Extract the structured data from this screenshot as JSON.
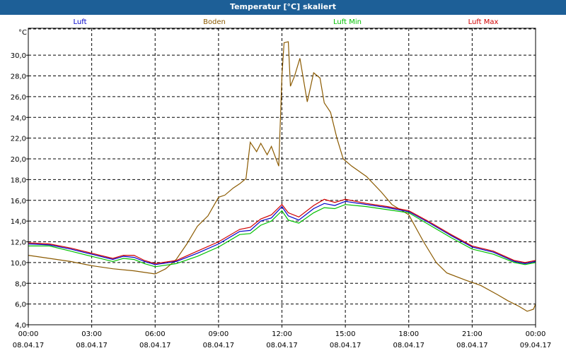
{
  "window": {
    "title": "Temperatur [°C] skaliert"
  },
  "chart_data": {
    "type": "line",
    "title": "Temperatur [°C] skaliert",
    "ylabel": "°C",
    "xlabel": "",
    "ylim": [
      4,
      32.6
    ],
    "xlim": [
      0,
      24
    ],
    "grid": true,
    "legend_position": "top",
    "yticks": [
      "4,0",
      "6,0",
      "8,0",
      "10,0",
      "12,0",
      "14,0",
      "16,0",
      "18,0",
      "20,0",
      "22,0",
      "24,0",
      "26,0",
      "28,0",
      "30,0"
    ],
    "xticks": [
      {
        "time": "00:00",
        "date": "08.04.17"
      },
      {
        "time": "03:00",
        "date": "08.04.17"
      },
      {
        "time": "06:00",
        "date": "08.04.17"
      },
      {
        "time": "09:00",
        "date": "08.04.17"
      },
      {
        "time": "12:00",
        "date": "08.04.17"
      },
      {
        "time": "15:00",
        "date": "08.04.17"
      },
      {
        "time": "18:00",
        "date": "08.04.17"
      },
      {
        "time": "21:00",
        "date": "08.04.17"
      },
      {
        "time": "00:00",
        "date": "09.04.17"
      }
    ],
    "series": [
      {
        "name": "Luft",
        "color": "#0000c8",
        "x": [
          0,
          1,
          2,
          3,
          4,
          4.5,
          5,
          5.5,
          6,
          7,
          8,
          9,
          10,
          10.5,
          11,
          11.5,
          12,
          12.3,
          12.8,
          13.5,
          14,
          14.5,
          15,
          16,
          17,
          18,
          19,
          20,
          21,
          22,
          23,
          23.5,
          24
        ],
        "y": [
          11.8,
          11.7,
          11.3,
          10.8,
          10.3,
          10.6,
          10.5,
          10.1,
          9.8,
          10.1,
          10.9,
          11.8,
          13.0,
          13.1,
          14.0,
          14.3,
          15.4,
          14.5,
          14.1,
          15.2,
          15.7,
          15.5,
          15.9,
          15.6,
          15.3,
          14.9,
          13.8,
          12.6,
          11.5,
          11.0,
          10.1,
          9.9,
          10.1
        ]
      },
      {
        "name": "Boden",
        "color": "#8b5a00",
        "x": [
          0,
          1,
          2,
          3,
          4,
          5,
          6,
          6.5,
          7,
          7.5,
          8,
          8.5,
          9,
          9.3,
          9.7,
          10,
          10.3,
          10.5,
          10.8,
          11,
          11.3,
          11.5,
          11.85,
          12.0,
          12.1,
          12.3,
          12.4,
          12.6,
          12.85,
          13.2,
          13.5,
          13.8,
          14.0,
          14.3,
          14.6,
          14.9,
          15.3,
          16,
          16.7,
          17.2,
          18,
          18.7,
          19.3,
          19.8,
          20.7,
          21.4,
          22.2,
          22.7,
          23.2,
          23.6,
          23.9,
          24
        ],
        "y": [
          10.7,
          10.4,
          10.1,
          9.7,
          9.4,
          9.2,
          8.9,
          9.4,
          10.3,
          11.8,
          13.5,
          14.5,
          16.3,
          16.5,
          17.2,
          17.6,
          18.1,
          21.6,
          20.7,
          21.5,
          20.4,
          21.2,
          19.3,
          28.0,
          31.2,
          31.3,
          27.0,
          28.0,
          29.7,
          25.5,
          28.3,
          27.8,
          25.4,
          24.5,
          22.0,
          20.0,
          19.3,
          18.3,
          16.8,
          15.6,
          14.6,
          12.0,
          10.0,
          9.0,
          8.3,
          7.8,
          6.9,
          6.3,
          5.8,
          5.3,
          5.5,
          6.0
        ]
      },
      {
        "name": "Luft Min",
        "color": "#00c000",
        "x": [
          0,
          1,
          2,
          3,
          4,
          4.5,
          5,
          5.5,
          6,
          7,
          8,
          9,
          10,
          10.5,
          11,
          11.5,
          12,
          12.3,
          12.8,
          13.5,
          14,
          14.5,
          15,
          16,
          17,
          18,
          19,
          20,
          21,
          22,
          23,
          23.5,
          24
        ],
        "y": [
          11.6,
          11.6,
          11.1,
          10.6,
          10.1,
          10.4,
          10.3,
          9.9,
          9.6,
          9.9,
          10.6,
          11.5,
          12.7,
          12.8,
          13.6,
          14.0,
          15.0,
          14.1,
          13.8,
          14.8,
          15.3,
          15.2,
          15.6,
          15.4,
          15.1,
          14.8,
          13.6,
          12.4,
          11.3,
          10.8,
          10.0,
          9.8,
          10.0
        ]
      },
      {
        "name": "Luft Max",
        "color": "#d00000",
        "x": [
          0,
          1,
          2,
          3,
          4,
          4.5,
          5,
          5.5,
          6,
          7,
          8,
          9,
          10,
          10.5,
          11,
          11.5,
          12,
          12.3,
          12.8,
          13.5,
          14,
          14.5,
          15,
          16,
          17,
          18,
          19,
          20,
          21,
          22,
          23,
          23.5,
          24
        ],
        "y": [
          11.9,
          11.8,
          11.4,
          10.9,
          10.4,
          10.7,
          10.7,
          10.2,
          9.9,
          10.2,
          11.1,
          12.0,
          13.2,
          13.4,
          14.2,
          14.6,
          15.6,
          14.8,
          14.4,
          15.5,
          16.1,
          15.8,
          16.1,
          15.7,
          15.4,
          15.0,
          13.9,
          12.7,
          11.6,
          11.1,
          10.2,
          10.0,
          10.2
        ]
      }
    ]
  }
}
